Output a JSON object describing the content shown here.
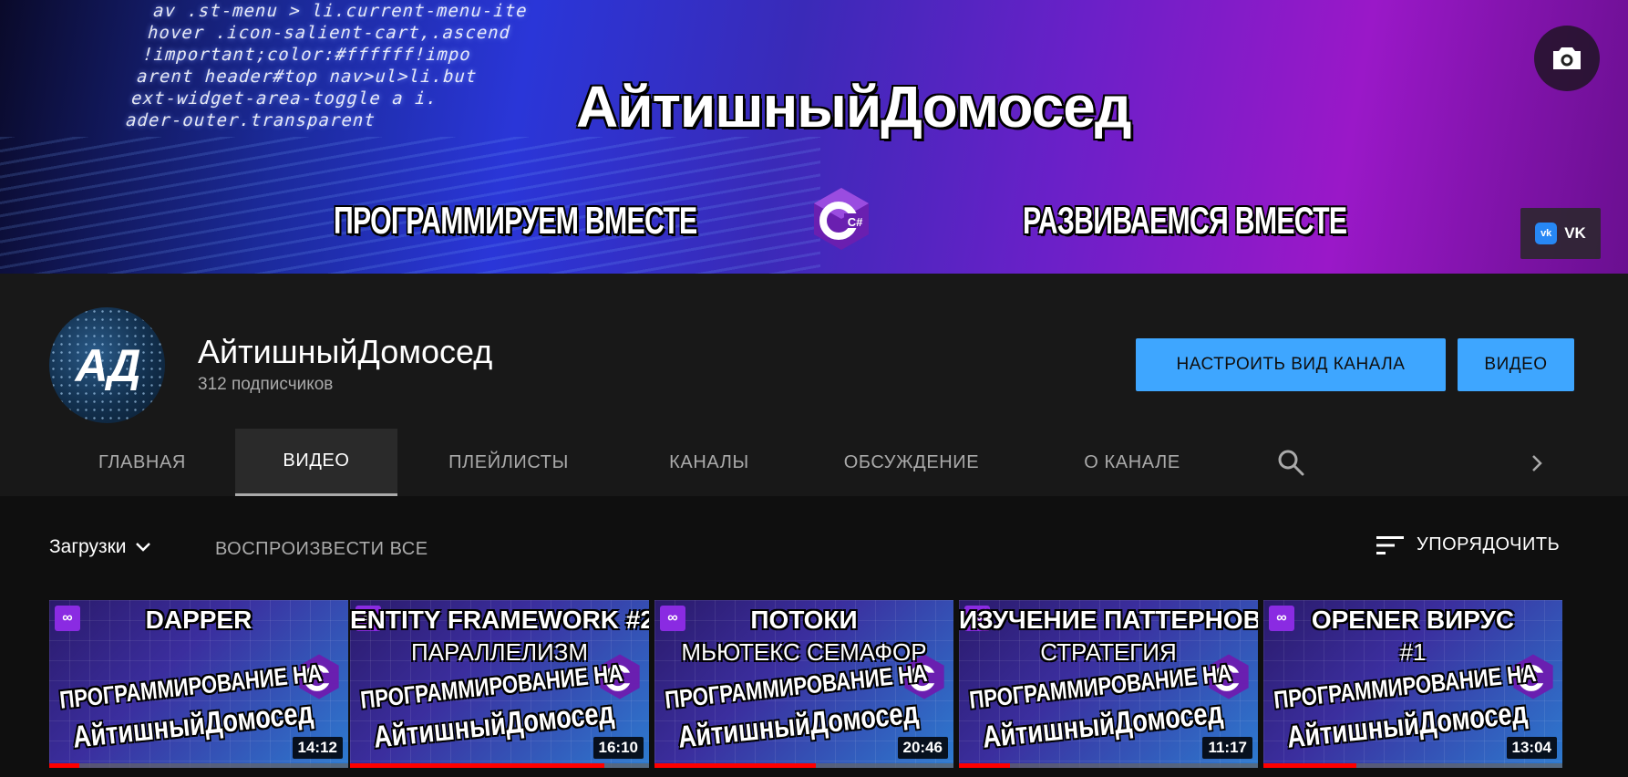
{
  "banner": {
    "code_lines": [
      "av .st-menu > li.current-menu-ite",
      "hover .icon-salient-cart,.ascend",
      "!important;color:#ffffff!impo",
      "arent header#top nav>ul>li.but",
      "ext-widget-area-toggle a i.",
      "ader-outer.transparent"
    ],
    "title": "АйтишныйДомосед",
    "slogan_left": "ПРОГРАММИРУЕМ ВМЕСТЕ",
    "slogan_right": "РАЗВИВАЕМСЯ ВМЕСТЕ",
    "logo_glyph": "C#",
    "vk_label": "VK",
    "vk_badge": "vk",
    "camera_icon": "camera-icon"
  },
  "channel": {
    "avatar_text": "АД",
    "name": "АйтишныйДомосед",
    "subscribers": "312 подписчиков",
    "customize_label": "НАСТРОИТЬ ВИД КАНАЛА",
    "videos_label": "ВИДЕО"
  },
  "tabs": [
    {
      "label": "ГЛАВНАЯ",
      "active": false
    },
    {
      "label": "ВИДЕО",
      "active": true
    },
    {
      "label": "ПЛЕЙЛИСТЫ",
      "active": false
    },
    {
      "label": "КАНАЛЫ",
      "active": false
    },
    {
      "label": "ОБСУЖДЕНИЕ",
      "active": false
    },
    {
      "label": "О КАНАЛЕ",
      "active": false
    }
  ],
  "toolbar": {
    "uploads_label": "Загрузки",
    "play_all_label": "ВОСПРОИЗВЕСТИ ВСЕ",
    "sort_label": "УПОРЯДОЧИТЬ"
  },
  "videos": [
    {
      "line1": "DAPPER",
      "line2": "",
      "program_text": "ПРОГРАММИРОВАНИЕ НА",
      "brand": "АйтишныйДомосед",
      "duration": "14:12",
      "watched": 0.1
    },
    {
      "line1": "ENTITY FRAMEWORK #2",
      "line2": "ПАРАЛЛЕЛИЗМ",
      "program_text": "ПРОГРАММИРОВАНИЕ НА",
      "brand": "АйтишныйДомосед",
      "duration": "16:10",
      "watched": 0.85
    },
    {
      "line1": "ПОТОКИ",
      "line2": "МЬЮТЕКС СЕМАФОР",
      "program_text": "ПРОГРАММИРОВАНИЕ НА",
      "brand": "АйтишныйДомосед",
      "duration": "20:46",
      "watched": 0.54
    },
    {
      "line1": "ИЗУЧЕНИЕ ПАТТЕРНОВ",
      "line2": "СТРАТЕГИЯ",
      "program_text": "ПРОГРАММИРОВАНИЕ НА",
      "brand": "АйтишныйДомосед",
      "duration": "11:17",
      "watched": 0.17
    },
    {
      "line1": "OPENER ВИРУС",
      "line2": "#1",
      "program_text": "ПРОГРАММИРОВАНИЕ НА",
      "brand": "АйтишныйДомосед",
      "duration": "13:04",
      "watched": 0.31
    }
  ],
  "colors": {
    "accent": "#3ea6ff",
    "progress": "#ff0000",
    "background": "#181818",
    "content_bg": "#0f0f0f"
  }
}
